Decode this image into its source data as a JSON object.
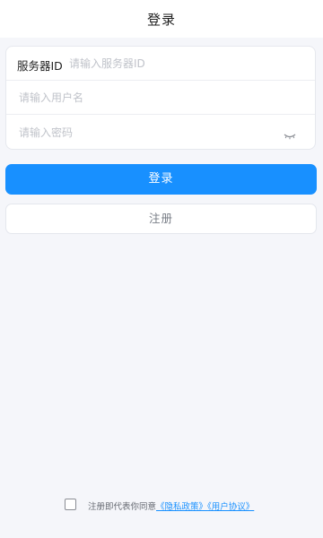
{
  "header": {
    "title": "登录"
  },
  "form": {
    "server_label": "服务器ID",
    "server_placeholder": "请输入服务器ID",
    "username_placeholder": "请输入用户名",
    "password_placeholder": "请输入密码",
    "password_toggle_icon": "eye-closed-icon"
  },
  "actions": {
    "login_label": "登录",
    "register_label": "注册"
  },
  "agreement": {
    "prefix": "注册即代表你同意",
    "privacy_link": "《隐私政策》",
    "user_link": "《用户协议》",
    "checked": false
  },
  "colors": {
    "accent": "#1890ff",
    "background": "#f5f6fa"
  }
}
